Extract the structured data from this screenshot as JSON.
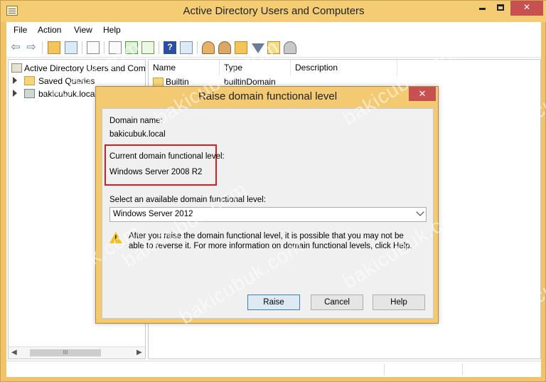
{
  "window": {
    "title": "Active Directory Users and Computers",
    "controls": {
      "minimize": "",
      "maximize": "",
      "close": "✕"
    }
  },
  "menu": [
    "File",
    "Action",
    "View",
    "Help"
  ],
  "toolbar": {
    "icons": [
      "back-arrow-icon",
      "forward-arrow-icon",
      "up-folder-icon",
      "show-hide-tree-icon",
      "properties-icon",
      "copy-icon",
      "refresh-icon",
      "export-icon",
      "help-icon",
      "console-icon",
      "new-user-icon",
      "new-group-icon",
      "new-ou-icon",
      "filter-icon",
      "find-icon",
      "delegate-icon"
    ]
  },
  "tree": {
    "items": [
      {
        "label": "Active Directory Users and Com",
        "icon": "ad-console-icon",
        "expandable": false
      },
      {
        "label": "Saved Queries",
        "icon": "folder-icon",
        "expandable": true
      },
      {
        "label": "bakicubuk.local",
        "icon": "domain-icon",
        "expandable": true
      }
    ],
    "scroll_thumb": "III"
  },
  "list": {
    "columns": [
      "Name",
      "Type",
      "Description"
    ],
    "rows": [
      {
        "name": "Builtin",
        "type": "builtinDomain",
        "description": ""
      }
    ]
  },
  "dialog": {
    "title": "Raise domain functional level",
    "close": "✕",
    "domain_name_label": "Domain name:",
    "domain_name": "bakicubuk.local",
    "current_level_label": "Current domain functional level:",
    "current_level": "Windows Server 2008 R2",
    "select_label": "Select an available domain functional level:",
    "select_value": "Windows Server 2012",
    "warning": "After you raise the domain functional level, it is possible that you may not be able to reverse it. For more information on domain functional levels, click Help.",
    "buttons": {
      "raise": "Raise",
      "cancel": "Cancel",
      "help": "Help"
    }
  },
  "watermark": "bakicubuk.com"
}
